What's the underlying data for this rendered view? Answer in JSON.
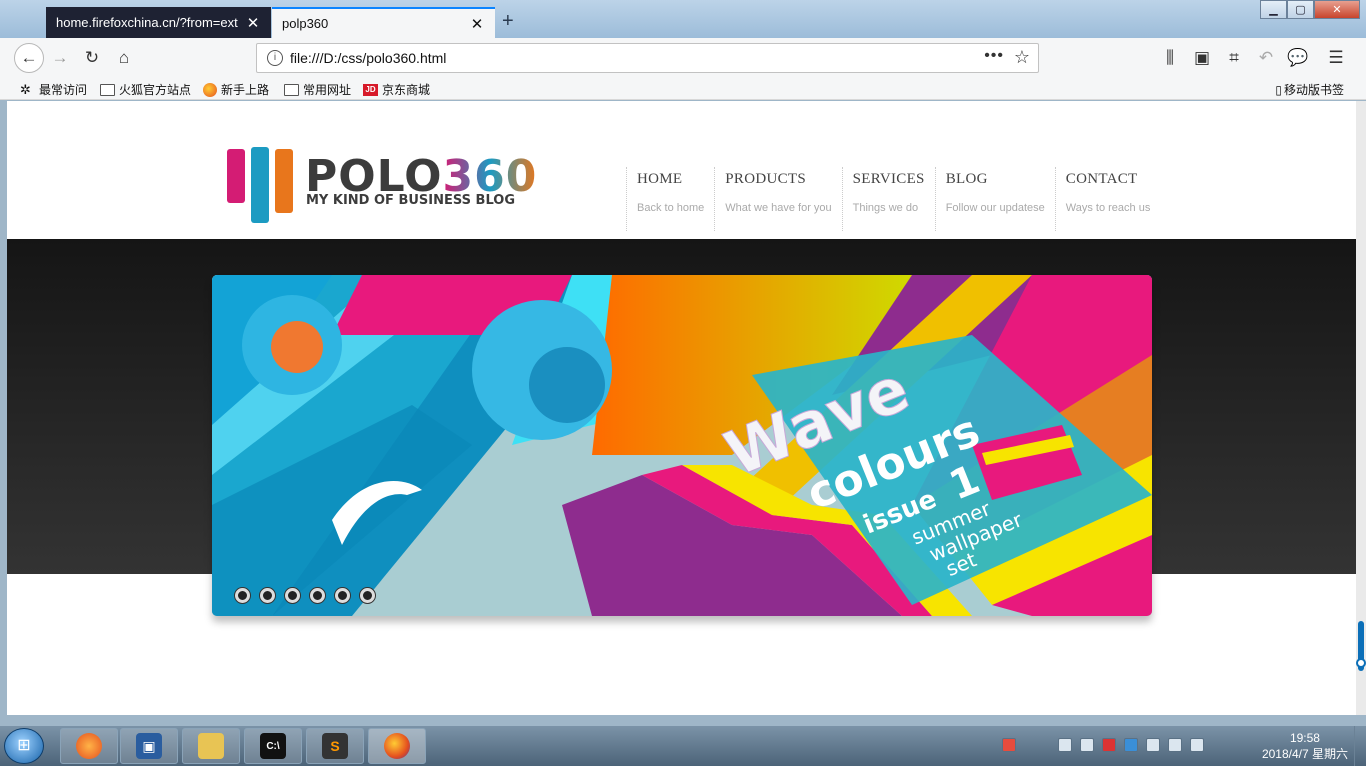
{
  "browser": {
    "tabs": [
      {
        "title": "home.firefoxchina.cn/?from=ext",
        "active": false
      },
      {
        "title": "polp360",
        "active": true
      }
    ],
    "url": "file:///D:/css/polo360.html",
    "page_actions_label": "•••",
    "bookmarks": [
      {
        "label": "最常访问",
        "icon": "gear-icon"
      },
      {
        "label": "火狐官方站点",
        "icon": "folder-icon"
      },
      {
        "label": "新手上路",
        "icon": "firefox-icon"
      },
      {
        "label": "常用网址",
        "icon": "folder-icon"
      },
      {
        "label": "京东商城",
        "icon": "jd-icon"
      }
    ],
    "mobile_bookmarks": "移动版书签",
    "accent": "#0a84ff"
  },
  "page": {
    "logo": {
      "word_main": "POLO",
      "word_num": "360",
      "tagline": "MY KIND OF BUSINESS BLOG"
    },
    "menu": [
      {
        "title": "HOME",
        "subtitle": "Back to home"
      },
      {
        "title": "PRODUCTS",
        "subtitle": "What we have for you"
      },
      {
        "title": "SERVICES",
        "subtitle": "Things we do"
      },
      {
        "title": "BLOG",
        "subtitle": "Follow our updatese"
      },
      {
        "title": "CONTACT",
        "subtitle": "Ways to reach us"
      }
    ],
    "slider": {
      "text_wave": "Wave",
      "text_colours": "colours",
      "text_issue": "issue",
      "text_issue_num": "1",
      "text_summer": "summer",
      "text_wallpaper": "wallpaper",
      "text_set": "set",
      "slide_count": 6,
      "colors": [
        "#1ba3d3",
        "#e8197d",
        "#c6ef00",
        "#f7e400",
        "#e67e22",
        "#8e2c8e"
      ]
    }
  },
  "taskbar": {
    "start_label": "Start",
    "apps": [
      "firefox-fox",
      "virtualbox",
      "explorer",
      "cmd",
      "sublime-text",
      "firefox"
    ],
    "clock_time": "19:58",
    "clock_date": "2018/4/7 星期六"
  }
}
